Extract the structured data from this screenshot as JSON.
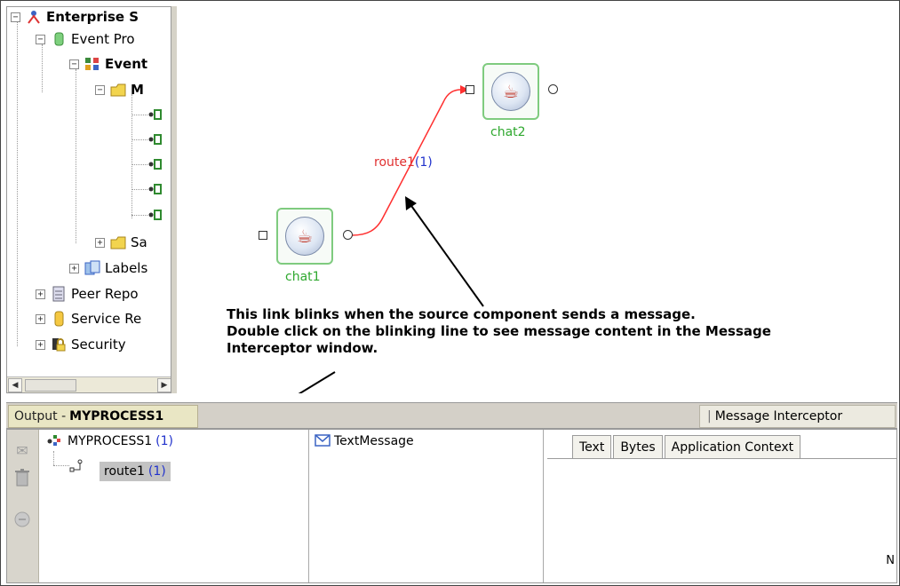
{
  "tree": {
    "items": [
      {
        "label": "Enterprise S",
        "expander": "minus",
        "icon": "enterprise-icon",
        "bold": true
      },
      {
        "label": "Event Pro",
        "expander": "minus",
        "icon": "database-icon",
        "bold": false
      },
      {
        "label": "Event",
        "expander": "minus",
        "icon": "event-process-icon",
        "bold": true
      },
      {
        "label": "M",
        "expander": "minus",
        "icon": "folder-icon",
        "bold": true
      },
      {
        "label": "Sa",
        "expander": "plus",
        "icon": "folder-icon",
        "bold": false
      },
      {
        "label": "Labels",
        "expander": "plus",
        "icon": "labels-icon",
        "bold": false
      },
      {
        "label": "Peer Repo",
        "expander": "plus",
        "icon": "repository-icon",
        "bold": false
      },
      {
        "label": "Service Re",
        "expander": "plus",
        "icon": "service-icon",
        "bold": false
      },
      {
        "label": "Security",
        "expander": "plus",
        "icon": "security-icon",
        "bold": false
      }
    ],
    "scroll_left": "◀",
    "scroll_right": "▶"
  },
  "canvas": {
    "components": [
      {
        "label": "chat1",
        "icon": "java-cup-icon"
      },
      {
        "label": "chat2",
        "icon": "java-cup-icon"
      }
    ],
    "route": {
      "name": "route1",
      "count": "(1)",
      "color": "#ff3030"
    },
    "annotation": {
      "line1": "This link blinks when the source component sends a message.",
      "line2": "Double click on the blinking line to see message content in the Message",
      "line3": "Interceptor window."
    }
  },
  "bottom": {
    "output_tab": {
      "prefix": "Output -",
      "process": "MYPROCESS1"
    },
    "interceptor_tab": "Message Interceptor",
    "tools": [
      "envelope-icon",
      "trash-icon",
      "stop-icon"
    ],
    "message_tree": {
      "process": {
        "label": "MYPROCESS1",
        "count": "(1)"
      },
      "route": {
        "label": "route1",
        "count": "(1)"
      }
    },
    "message_list": [
      {
        "label": "TextMessage",
        "icon": "envelope-icon"
      }
    ],
    "detail_tabs": [
      "Text",
      "Bytes",
      "Application Context"
    ],
    "edge_text": "N"
  },
  "colors": {
    "component_border": "#7fcb7f",
    "component_label": "#2fa82f",
    "route": "#ff3030",
    "count": "#2233cc",
    "output_tab_bg": "#e9e6c4"
  }
}
